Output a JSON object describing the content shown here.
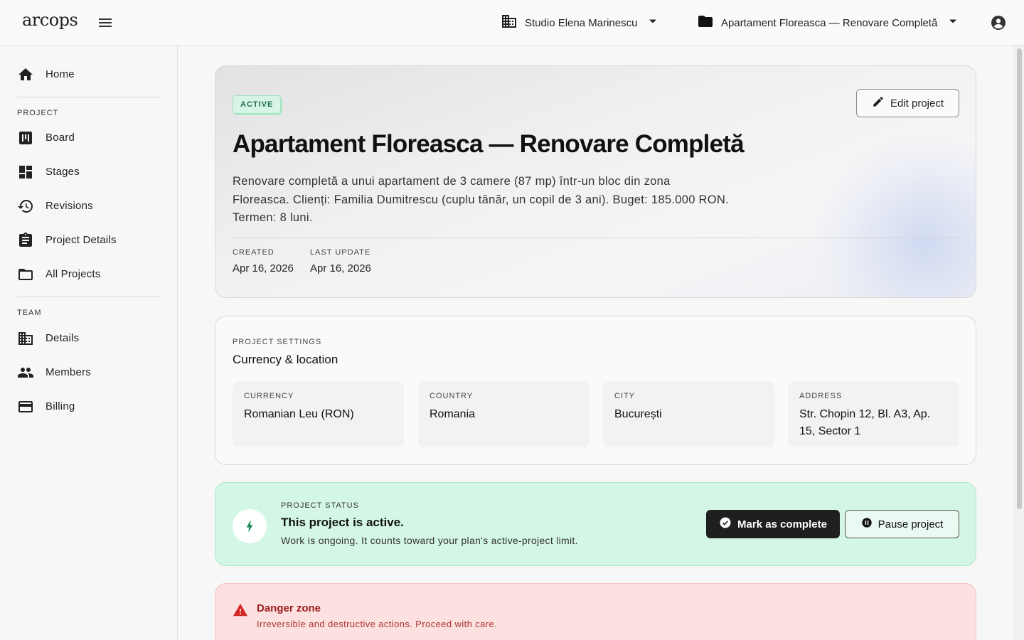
{
  "app": {
    "logo": "arcops"
  },
  "header": {
    "studio": "Studio Elena Marinescu",
    "project": "Apartament Floreasca — Renovare Completă"
  },
  "sidebar": {
    "home": "Home",
    "project_section": "PROJECT",
    "project_items": [
      "Board",
      "Stages",
      "Revisions",
      "Project Details",
      "All Projects"
    ],
    "team_section": "TEAM",
    "team_items": [
      "Details",
      "Members",
      "Billing"
    ]
  },
  "hero": {
    "status_badge": "ACTIVE",
    "edit_label": "Edit project",
    "title": "Apartament Floreasca — Renovare Completă",
    "description": "Renovare completă a unui apartament de 3 camere (87 mp) într-un bloc din zona Floreasca. Clienți: Familia Dumitrescu (cuplu tânăr, un copil de 3 ani). Buget: 185.000 RON. Termen: 8 luni.",
    "created_label": "CREATED",
    "created_value": "Apr 16, 2026",
    "updated_label": "LAST UPDATE",
    "updated_value": "Apr 16, 2026"
  },
  "settings": {
    "section_label": "PROJECT SETTINGS",
    "title": "Currency & location",
    "tiles": [
      {
        "label": "CURRENCY",
        "value": "Romanian Leu (RON)"
      },
      {
        "label": "COUNTRY",
        "value": "Romania"
      },
      {
        "label": "CITY",
        "value": "București"
      },
      {
        "label": "ADDRESS",
        "value": "Str. Chopin 12, Bl. A3, Ap. 15, Sector 1"
      }
    ]
  },
  "status": {
    "section_label": "PROJECT STATUS",
    "title": "This project is active.",
    "description": "Work is ongoing. It counts toward your plan's active-project limit.",
    "complete_label": "Mark as complete",
    "pause_label": "Pause project"
  },
  "danger": {
    "title": "Danger zone",
    "description": "Irreversible and destructive actions. Proceed with care."
  },
  "colors": {
    "active_green": "#1e6b47",
    "status_bg": "#d4f7e5",
    "danger_bg": "#fde0e0",
    "danger_text": "#9a1c1c"
  }
}
